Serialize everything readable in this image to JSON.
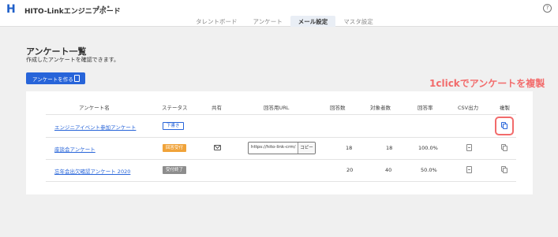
{
  "header": {
    "logo": "H",
    "app_title": "HITO-Linkエンジニアボード",
    "more": "•••",
    "help": "?",
    "tabs": [
      {
        "label": "タレントボード",
        "active": false
      },
      {
        "label": "アンケート",
        "active": false
      },
      {
        "label": "メール設定",
        "active": true
      },
      {
        "label": "マスタ設定",
        "active": false
      }
    ]
  },
  "page": {
    "title": "アンケート一覧",
    "subtitle": "作成したアンケートを確認できます。",
    "create_button": "アンケートを作る"
  },
  "table": {
    "columns": [
      "アンケート名",
      "ステータス",
      "共有",
      "回答用URL",
      "回答数",
      "対象者数",
      "回答率",
      "CSV出力",
      "複製"
    ],
    "rows": [
      {
        "name": "エンジニアイベント参加アンケート",
        "status": "下書き",
        "share": "",
        "url": "",
        "copy": "",
        "answers": "",
        "targets": "",
        "rate": ""
      },
      {
        "name": "座談会アンケート",
        "status": "回答受付",
        "share": "mail-icon",
        "url": "https://hito-link-crm/",
        "copy": "コピー",
        "answers": "18",
        "targets": "18",
        "rate": "100.0%"
      },
      {
        "name": "忘年会出欠確認アンケート 2020",
        "status": "受付終了",
        "share": "",
        "url": "",
        "copy": "",
        "answers": "20",
        "targets": "40",
        "rate": "50.0%"
      }
    ]
  },
  "annotation": {
    "text": "1clickでアンケートを複製",
    "color": "#f26b6b"
  },
  "colors": {
    "accent": "#2764d9",
    "draft": "#2764d9",
    "open": "#f0a33a",
    "closed": "#8d8d8d"
  }
}
